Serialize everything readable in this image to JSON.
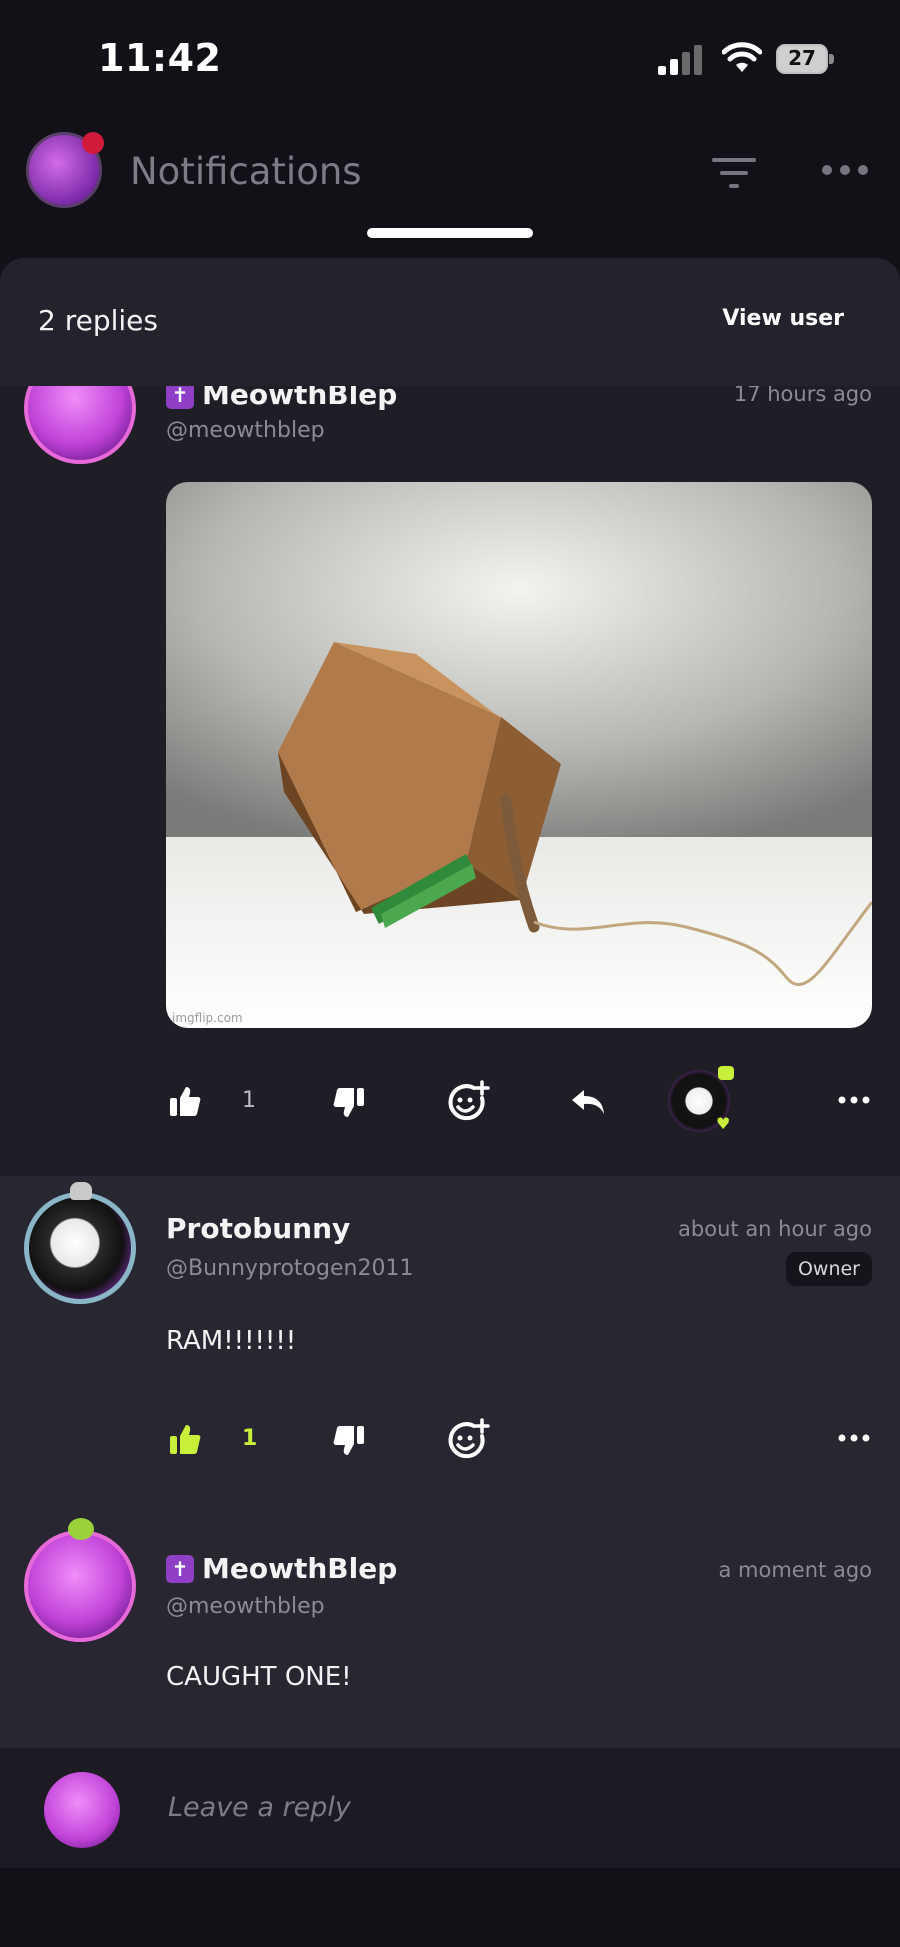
{
  "status_bar": {
    "time": "11:42",
    "battery": "27"
  },
  "header": {
    "title": "Notifications"
  },
  "sheet": {
    "replies_label": "2 replies",
    "view_user_label": "View user"
  },
  "posts": [
    {
      "username": "MeowthBlep",
      "handle": "@meowthblep",
      "time": "17 hours ago",
      "image_alt": "cardboard box trap propped on a stick with RAM sticks as bait",
      "image_watermark": "imgflip.com",
      "like_count": "1"
    },
    {
      "username": "Protobunny",
      "handle": "@Bunnyprotogen2011",
      "time": "about an hour ago",
      "role_badge": "Owner",
      "text": "RAM!!!!!!!",
      "like_count": "1"
    },
    {
      "username": "MeowthBlep",
      "handle": "@meowthblep",
      "time": "a moment ago",
      "text": "CAUGHT ONE!"
    }
  ],
  "composer": {
    "placeholder": "Leave a reply"
  },
  "colors": {
    "accent_green": "#c8f03a",
    "badge_purple": "#8f3fc6",
    "bg": "#121118"
  }
}
